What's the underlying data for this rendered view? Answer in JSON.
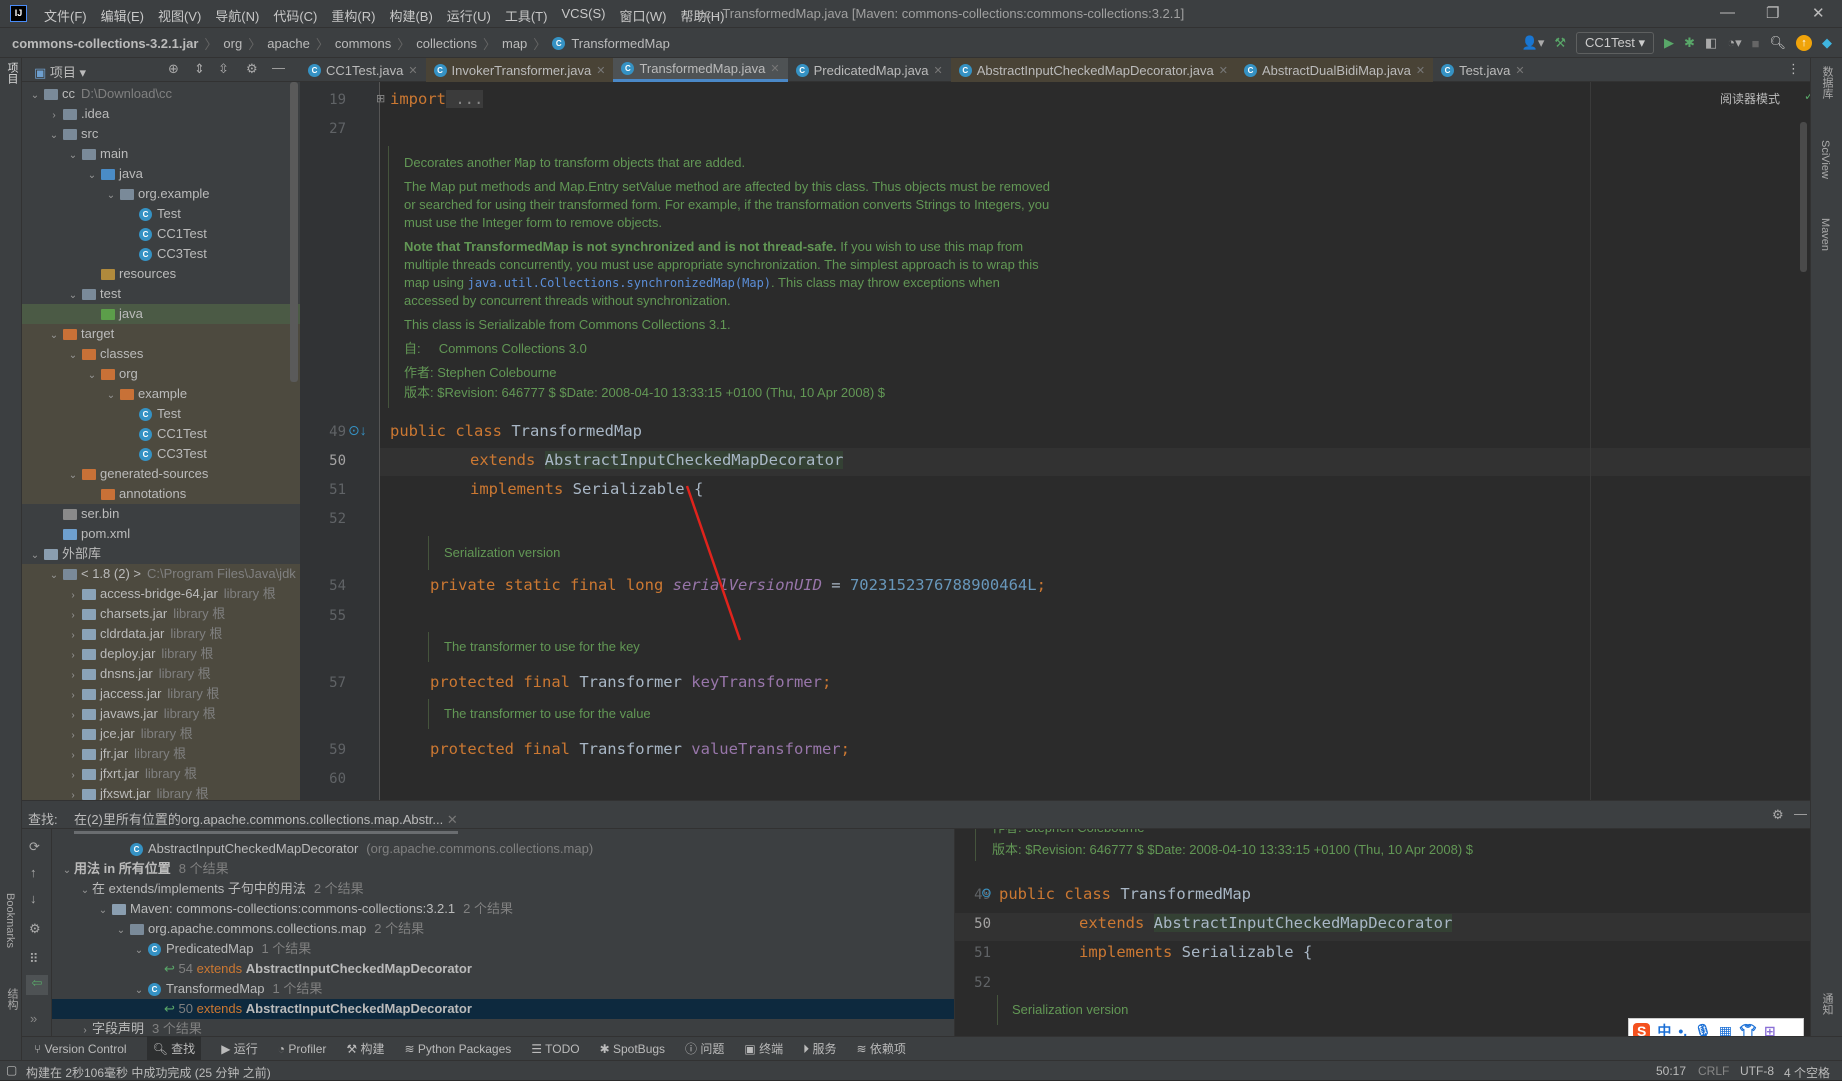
{
  "menu": [
    "文件(F)",
    "编辑(E)",
    "视图(V)",
    "导航(N)",
    "代码(C)",
    "重构(R)",
    "构建(B)",
    "运行(U)",
    "工具(T)",
    "VCS(S)",
    "窗口(W)",
    "帮助(H)"
  ],
  "window_title": "cc - TransformedMap.java [Maven: commons-collections:commons-collections:3.2.1]",
  "breadcrumb": [
    "commons-collections-3.2.1.jar",
    "org",
    "apache",
    "commons",
    "collections",
    "map",
    "TransformedMap"
  ],
  "run_config": "CC1Test",
  "project": {
    "title": "项目",
    "tree": [
      {
        "d": 0,
        "e": "v",
        "icon": "folder",
        "label": "cc",
        "hint": "D:\\Download\\cc"
      },
      {
        "d": 1,
        "e": ">",
        "icon": "folder",
        "label": ".idea"
      },
      {
        "d": 1,
        "e": "v",
        "icon": "folder",
        "label": "src"
      },
      {
        "d": 2,
        "e": "v",
        "icon": "folder",
        "label": "main"
      },
      {
        "d": 3,
        "e": "v",
        "icon": "src",
        "label": "java"
      },
      {
        "d": 4,
        "e": "v",
        "icon": "pkg",
        "label": "org.example"
      },
      {
        "d": 5,
        "e": "",
        "icon": "class",
        "label": "Test"
      },
      {
        "d": 5,
        "e": "",
        "icon": "class",
        "label": "CC1Test"
      },
      {
        "d": 5,
        "e": "",
        "icon": "class",
        "label": "CC3Test"
      },
      {
        "d": 3,
        "e": "",
        "icon": "res",
        "label": "resources"
      },
      {
        "d": 2,
        "e": "v",
        "icon": "folder",
        "label": "test"
      },
      {
        "d": 3,
        "e": "",
        "icon": "test",
        "label": "java",
        "sel": true
      },
      {
        "d": 1,
        "e": "v",
        "icon": "excl",
        "label": "target",
        "ex": true
      },
      {
        "d": 2,
        "e": "v",
        "icon": "excl",
        "label": "classes",
        "ex": true
      },
      {
        "d": 3,
        "e": "v",
        "icon": "excl",
        "label": "org",
        "ex": true
      },
      {
        "d": 4,
        "e": "v",
        "icon": "excl",
        "label": "example",
        "ex": true
      },
      {
        "d": 5,
        "e": "",
        "icon": "class",
        "label": "Test",
        "ex": true
      },
      {
        "d": 5,
        "e": "",
        "icon": "class",
        "label": "CC1Test",
        "ex": true
      },
      {
        "d": 5,
        "e": "",
        "icon": "class",
        "label": "CC3Test",
        "ex": true
      },
      {
        "d": 2,
        "e": "v",
        "icon": "excl",
        "label": "generated-sources",
        "ex": true
      },
      {
        "d": 3,
        "e": "",
        "icon": "excl",
        "label": "annotations",
        "ex": true
      },
      {
        "d": 1,
        "e": "",
        "icon": "file",
        "label": "ser.bin"
      },
      {
        "d": 1,
        "e": "",
        "icon": "maven",
        "label": "pom.xml"
      },
      {
        "d": 0,
        "e": "v",
        "icon": "lib",
        "label": "外部库"
      },
      {
        "d": 1,
        "e": "v",
        "icon": "jdk",
        "label": "< 1.8 (2) >",
        "hint": "C:\\Program Files\\Java\\jdk",
        "ex": true
      },
      {
        "d": 2,
        "e": ">",
        "icon": "jar",
        "label": "access-bridge-64.jar",
        "hint": "library 根",
        "ex": true
      },
      {
        "d": 2,
        "e": ">",
        "icon": "jar",
        "label": "charsets.jar",
        "hint": "library 根",
        "ex": true
      },
      {
        "d": 2,
        "e": ">",
        "icon": "jar",
        "label": "cldrdata.jar",
        "hint": "library 根",
        "ex": true
      },
      {
        "d": 2,
        "e": ">",
        "icon": "jar",
        "label": "deploy.jar",
        "hint": "library 根",
        "ex": true
      },
      {
        "d": 2,
        "e": ">",
        "icon": "jar",
        "label": "dnsns.jar",
        "hint": "library 根",
        "ex": true
      },
      {
        "d": 2,
        "e": ">",
        "icon": "jar",
        "label": "jaccess.jar",
        "hint": "library 根",
        "ex": true
      },
      {
        "d": 2,
        "e": ">",
        "icon": "jar",
        "label": "javaws.jar",
        "hint": "library 根",
        "ex": true
      },
      {
        "d": 2,
        "e": ">",
        "icon": "jar",
        "label": "jce.jar",
        "hint": "library 根",
        "ex": true
      },
      {
        "d": 2,
        "e": ">",
        "icon": "jar",
        "label": "jfr.jar",
        "hint": "library 根",
        "ex": true
      },
      {
        "d": 2,
        "e": ">",
        "icon": "jar",
        "label": "jfxrt.jar",
        "hint": "library 根",
        "ex": true
      },
      {
        "d": 2,
        "e": ">",
        "icon": "jar",
        "label": "jfxswt.jar",
        "hint": "library 根",
        "ex": true
      }
    ]
  },
  "tabs": [
    {
      "label": "CC1Test.java"
    },
    {
      "label": "InvokerTransformer.java",
      "mod": true
    },
    {
      "label": "TransformedMap.java",
      "active": true
    },
    {
      "label": "PredicatedMap.java"
    },
    {
      "label": "AbstractInputCheckedMapDecorator.java",
      "mod": true
    },
    {
      "label": "AbstractDualBidiMap.java",
      "mod": true
    },
    {
      "label": "Test.java"
    }
  ],
  "editor": {
    "reader_mode": "阅读器模式",
    "import_line": {
      "no": "19",
      "kw": "import",
      "rest": " ..."
    },
    "line27": "27",
    "doc": {
      "p1a": "Decorates another ",
      "p1code": "Map",
      "p1b": " to transform objects that are added.",
      "p2": "The Map put methods and Map.Entry setValue method are affected by this class. Thus objects must be removed or searched for using their transformed form. For example, if the transformation converts Strings to Integers, you must use the Integer form to remove objects.",
      "p3bold": "Note that TransformedMap is not synchronized and is not thread-safe.",
      "p3a": " If you wish to use this map from multiple threads concurrently, you must use appropriate synchronization. The simplest approach is to wrap this map using ",
      "p3code": "java.util.Collections.synchronizedMap(Map)",
      "p3b": ". This class may throw exceptions when accessed by concurrent threads without synchronization.",
      "p4": "This class is Serializable from Commons Collections 3.1.",
      "since_label": "自:",
      "since": "Commons Collections 3.0",
      "author_label": "作者:",
      "author": "Stephen Colebourne",
      "version_label": "版本:",
      "version": "$Revision: 646777 $ $Date: 2008-04-10 13:33:15 +0100 (Thu, 10 Apr 2008) $"
    },
    "lines": {
      "l49": "49",
      "l50": "50",
      "l51": "51",
      "l52": "52",
      "l54": "54",
      "l55": "55",
      "l57": "57",
      "l59": "59",
      "l60": "60"
    },
    "code": {
      "public": "public",
      "class": "class",
      "classname": " TransformedMap",
      "extends": "extends",
      "superclass": "AbstractInputCheckedMapDecorator",
      "implements": "implements",
      "iface": " Serializable {",
      "private_static_final_long": "private static final long ",
      "serial": "serialVersionUID",
      "eq": " = ",
      "serialval": "7023152376788900464L",
      "semi": ";",
      "protected_final": "protected final ",
      "transformer": "Transformer ",
      "keyT": "keyTransformer",
      "valT": "valueTransformer"
    },
    "doc_serial": "Serialization version",
    "doc_key": "The transformer to use for the key",
    "doc_value": "The transformer to use for the value"
  },
  "find": {
    "label": "查找:",
    "tab": "在(2)里所有位置的org.apache.commons.collections.map.Abstr...",
    "rows": [
      {
        "d": 3,
        "e": "",
        "icon": "class",
        "label": "AbstractInputCheckedMapDecorator",
        "hint": "(org.apache.commons.collections.map)"
      },
      {
        "d": 0,
        "e": "v",
        "label": "用法 in 所有位置",
        "hint": "8 个结果",
        "bold": true
      },
      {
        "d": 1,
        "e": "v",
        "label": "在 extends/implements 子句中的用法",
        "hint": "2 个结果"
      },
      {
        "d": 2,
        "e": "v",
        "icon": "lib",
        "label": "Maven: commons-collections:commons-collections:3.2.1",
        "hint": "2 个结果"
      },
      {
        "d": 3,
        "e": "v",
        "icon": "pkg",
        "label": "org.apache.commons.collections.map",
        "hint": "2 个结果"
      },
      {
        "d": 4,
        "e": "v",
        "icon": "class",
        "label": "PredicatedMap",
        "hint": "1 个结果"
      },
      {
        "d": 5,
        "e": "",
        "usage": true,
        "no": "54",
        "kw": "extends",
        "label": "AbstractInputCheckedMapDecorator"
      },
      {
        "d": 4,
        "e": "v",
        "icon": "class",
        "label": "TransformedMap",
        "hint": "1 个结果"
      },
      {
        "d": 5,
        "e": "",
        "usage": true,
        "no": "50",
        "kw": "extends",
        "label": "AbstractInputCheckedMapDecorator",
        "sel": true
      },
      {
        "d": 1,
        "e": ">",
        "label": "字段声明",
        "hint": "3 个结果"
      }
    ]
  },
  "bottom_tabs": [
    "Version Control",
    "查找",
    "运行",
    "Profiler",
    "构建",
    "Python Packages",
    "TODO",
    "SpotBugs",
    "问题",
    "终端",
    "服务",
    "依赖项"
  ],
  "left_strip": {
    "project": "项目",
    "bookmarks": "Bookmarks",
    "structure": "结构"
  },
  "right_strip": {
    "db": "数据库",
    "sciview": "SciView",
    "maven": "Maven",
    "notify": "通知"
  },
  "status": {
    "message": "构建在 2秒106毫秒 中成功完成 (25 分钟 之前)",
    "position": "50:17",
    "line_sep": "CRLF",
    "encoding": "UTF-8",
    "indent": "4 个空格"
  },
  "ime": {
    "lang": "中"
  },
  "colors": {
    "accent": "#4a88c7",
    "keyword": "#cc7832",
    "doc": "#629755",
    "number": "#6897bb",
    "field": "#9876aa",
    "arrow": "#e0231c"
  }
}
